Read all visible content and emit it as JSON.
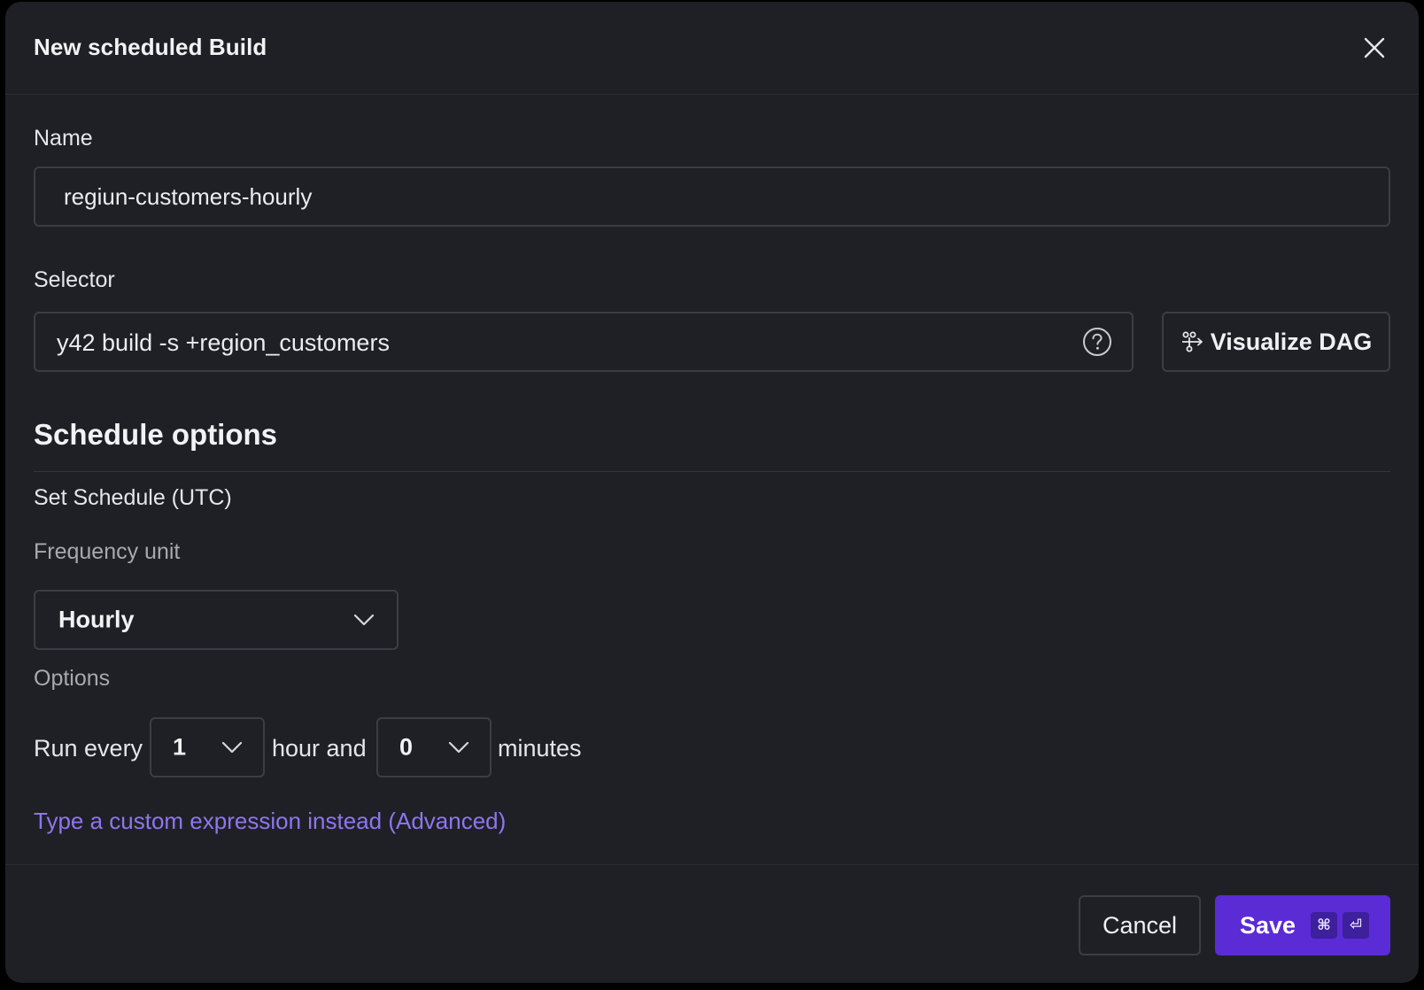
{
  "dialog": {
    "title": "New scheduled Build"
  },
  "name_field": {
    "label": "Name",
    "value": "regiun-customers-hourly"
  },
  "selector_field": {
    "label": "Selector",
    "value": "y42 build -s +region_customers",
    "help_icon": "question-circle-icon",
    "visualize_button": {
      "label": "Visualize DAG",
      "icon": "dag-icon"
    }
  },
  "schedule": {
    "section_title": "Schedule options",
    "set_schedule_label": "Set Schedule (UTC)",
    "frequency_unit": {
      "label": "Frequency unit",
      "value": "Hourly"
    },
    "options": {
      "label": "Options",
      "run_every_prefix": "Run every",
      "hours_value": "1",
      "middle_text": "hour and",
      "minutes_value": "0",
      "suffix": "minutes"
    },
    "custom_expression_link": "Type a custom expression instead (Advanced)"
  },
  "footer": {
    "cancel_label": "Cancel",
    "save_label": "Save",
    "save_shortcut": [
      "⌘",
      "⏎"
    ]
  },
  "colors": {
    "background": "#1f2025",
    "border": "#3c3d44",
    "accent": "#5b2bd6",
    "link": "#8f75f0"
  }
}
